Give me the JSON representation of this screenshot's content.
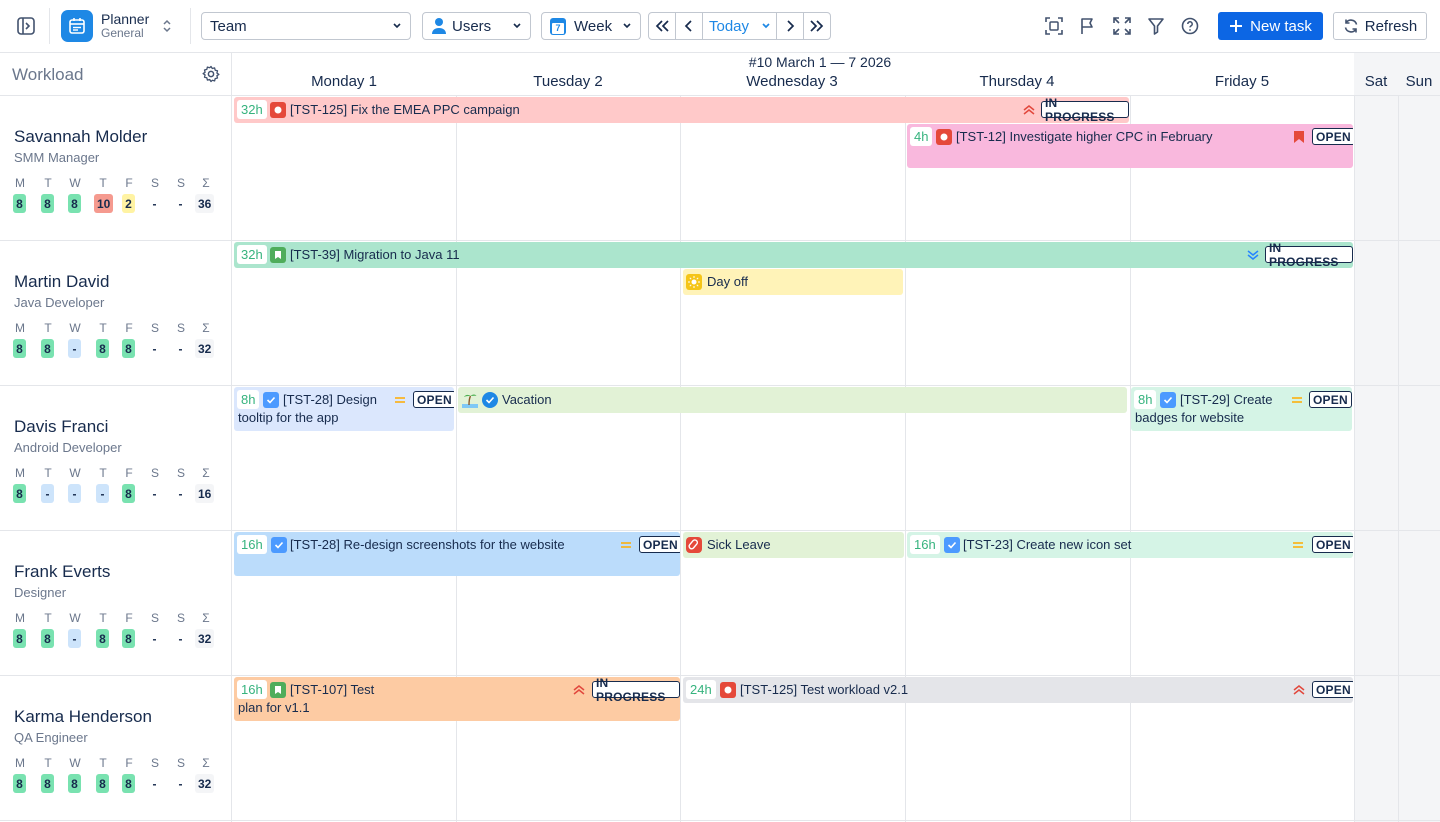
{
  "app": {
    "title": "Planner",
    "subtitle": "General"
  },
  "toolbar": {
    "team_select": "Team",
    "users_select": "Users",
    "week_select": "Week",
    "today_label": "Today",
    "calendar_day": "7",
    "new_task_label": "New task",
    "refresh_label": "Refresh"
  },
  "sidebar": {
    "title": "Workload"
  },
  "calendar": {
    "week_label": "#10 March 1 — 7 2026",
    "days": [
      "Monday 1",
      "Tuesday 2",
      "Wednesday 3",
      "Thursday 4",
      "Friday 5",
      "Sat",
      "Sun"
    ]
  },
  "day_letters": [
    "M",
    "T",
    "W",
    "T",
    "F",
    "S",
    "S",
    "Σ"
  ],
  "people": [
    {
      "name": "Savannah Molder",
      "role": "SMM Manager",
      "days": [
        "8",
        "8",
        "8",
        "10",
        "2",
        "-",
        "-"
      ],
      "total": "36"
    },
    {
      "name": "Martin David",
      "role": "Java Developer",
      "days": [
        "8",
        "8",
        "-",
        "8",
        "8",
        "-",
        "-"
      ],
      "total": "32"
    },
    {
      "name": "Davis Franci",
      "role": "Android Developer",
      "days": [
        "8",
        "-",
        "-",
        "-",
        "8",
        "-",
        "-"
      ],
      "total": "16"
    },
    {
      "name": "Frank Everts",
      "role": "Designer",
      "days": [
        "8",
        "8",
        "-",
        "8",
        "8",
        "-",
        "-"
      ],
      "total": "32"
    },
    {
      "name": "Karma Henderson",
      "role": "QA Engineer",
      "days": [
        "8",
        "8",
        "8",
        "8",
        "8",
        "-",
        "-"
      ],
      "total": "32"
    }
  ],
  "tasks": [
    {
      "hours": "32h",
      "text": "[TST-125] Fix the EMEA PPC campaign",
      "status": "IN PROGRESS"
    },
    {
      "hours": "4h",
      "text": "[TST-12] Investigate higher CPC in February",
      "status": "OPEN"
    },
    {
      "hours": "32h",
      "text": "[TST-39] Migration to Java 11",
      "status": "IN PROGRESS"
    },
    {
      "text": "Day off"
    },
    {
      "hours": "8h",
      "text": "[TST-28] Design tooltip for the app",
      "status": "OPEN"
    },
    {
      "text": "Vacation"
    },
    {
      "hours": "8h",
      "text": "[TST-29] Create badges for website",
      "status": "OPEN"
    },
    {
      "hours": "16h",
      "text": "[TST-28] Re-design screenshots for the website",
      "status": "OPEN"
    },
    {
      "text": "Sick Leave"
    },
    {
      "hours": "16h",
      "text": "[TST-23] Create new icon set",
      "status": "OPEN"
    },
    {
      "hours": "16h",
      "text": "[TST-107] Test plan for v1.1",
      "status": "IN PROGRESS"
    },
    {
      "hours": "24h",
      "text": "[TST-125] Test workload v2.1",
      "status": "OPEN"
    }
  ],
  "colors": {
    "accent": "#0c66e4",
    "hours_ok": "#79e2b0",
    "hours_over": "#f59a8f",
    "hours_low": "#fff3a3",
    "hours_none": "#cde4fb"
  }
}
